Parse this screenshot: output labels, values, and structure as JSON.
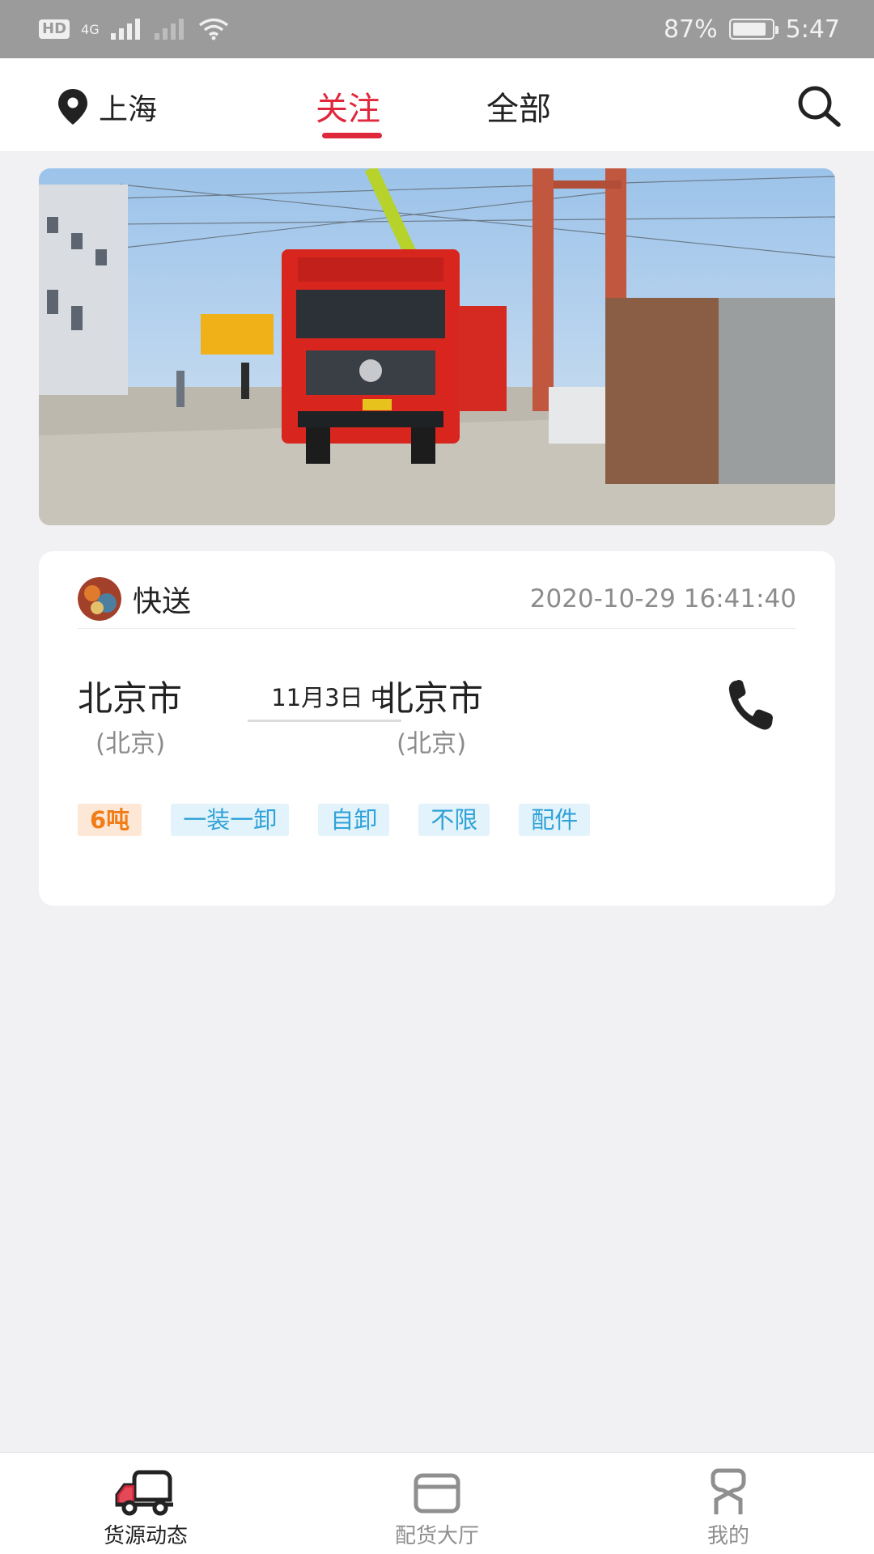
{
  "status_bar": {
    "hd": "HD",
    "network": "4G",
    "battery": "87%",
    "battery_level": 0.87,
    "time": "5:47"
  },
  "header": {
    "location": "上海",
    "tabs": [
      {
        "label": "关注",
        "active": true
      },
      {
        "label": "全部",
        "active": false
      }
    ]
  },
  "card": {
    "user": "快送",
    "timestamp": "2020-10-29 16:41:40",
    "from_city": "北京市",
    "from_province": "(北京)",
    "date": "11月3日 中",
    "to_city": "北京市",
    "to_province": "(北京)",
    "tags": [
      "6吨",
      "一装一卸",
      "自卸",
      "不限",
      "配件"
    ]
  },
  "bottom_nav": {
    "items": [
      {
        "label": "货源动态",
        "active": true
      },
      {
        "label": "配货大厅",
        "active": false
      },
      {
        "label": "我的",
        "active": false
      }
    ]
  },
  "colors": {
    "accent": "#e0283c",
    "tag_blue": "#2fa2d8",
    "tag_orange": "#f07d18"
  }
}
